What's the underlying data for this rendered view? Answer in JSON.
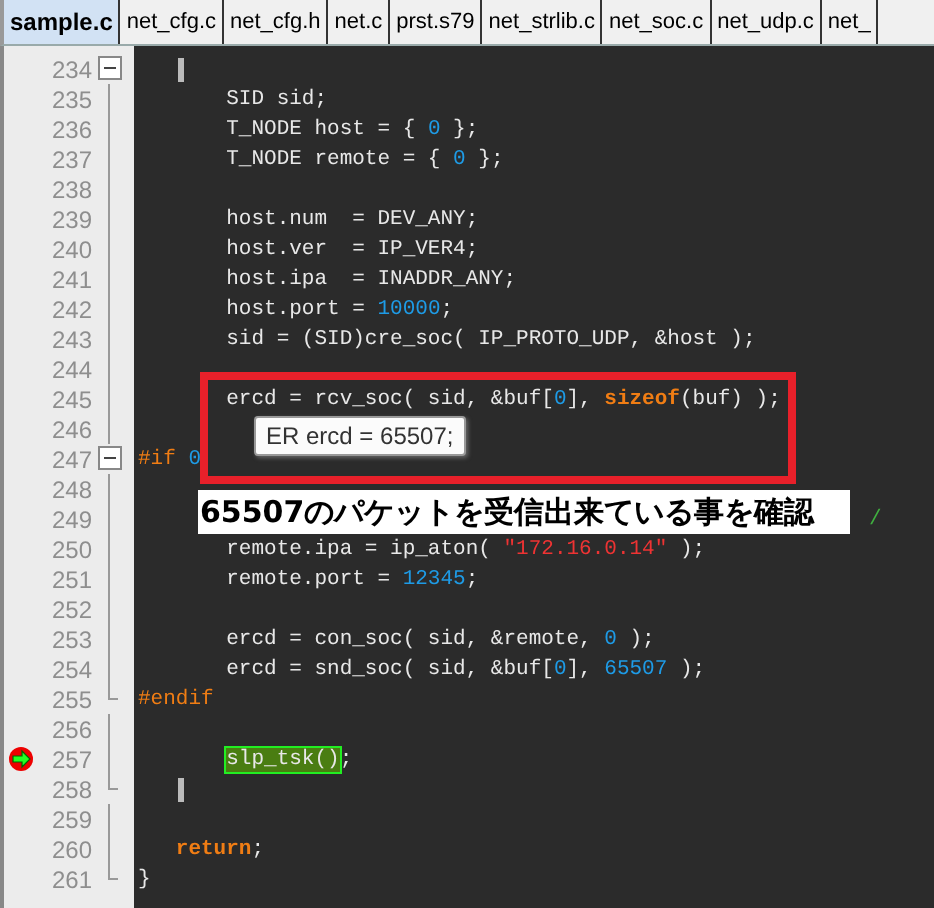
{
  "tabs": [
    {
      "label": "sample.c",
      "selected": true
    },
    {
      "label": "net_cfg.c",
      "selected": false
    },
    {
      "label": "net_cfg.h",
      "selected": false
    },
    {
      "label": "net.c",
      "selected": false
    },
    {
      "label": "prst.s79",
      "selected": false
    },
    {
      "label": "net_strlib.c",
      "selected": false
    },
    {
      "label": "net_soc.c",
      "selected": false
    },
    {
      "label": "net_udp.c",
      "selected": false
    },
    {
      "label": "net_",
      "selected": false
    }
  ],
  "lines": [
    {
      "number": "234",
      "kind": "fold-start",
      "current": false,
      "brace_match": true
    },
    {
      "number": "235",
      "kind": "body",
      "current": false,
      "brace_match": false,
      "tokens": [
        {
          "t": "       SID sid;",
          "kind": "plain"
        }
      ]
    },
    {
      "number": "236",
      "kind": "body",
      "current": false,
      "brace_match": false,
      "tokens": [
        {
          "t": "       T_NODE host = { ",
          "kind": "plain"
        },
        {
          "t": "0",
          "kind": "num"
        },
        {
          "t": " };",
          "kind": "plain"
        }
      ]
    },
    {
      "number": "237",
      "kind": "body",
      "current": false,
      "brace_match": false,
      "tokens": [
        {
          "t": "       T_NODE remote = { ",
          "kind": "plain"
        },
        {
          "t": "0",
          "kind": "num"
        },
        {
          "t": " };",
          "kind": "plain"
        }
      ]
    },
    {
      "number": "238",
      "kind": "body",
      "current": false,
      "brace_match": false
    },
    {
      "number": "239",
      "kind": "body",
      "current": false,
      "brace_match": false,
      "tokens": [
        {
          "t": "       host.num  = DEV_ANY;",
          "kind": "plain"
        }
      ]
    },
    {
      "number": "240",
      "kind": "body",
      "current": false,
      "brace_match": false,
      "tokens": [
        {
          "t": "       host.ver  = IP_VER4;",
          "kind": "plain"
        }
      ]
    },
    {
      "number": "241",
      "kind": "body",
      "current": false,
      "brace_match": false,
      "tokens": [
        {
          "t": "       host.ipa  = INADDR_ANY;",
          "kind": "plain"
        }
      ]
    },
    {
      "number": "242",
      "kind": "body",
      "current": false,
      "brace_match": false,
      "tokens": [
        {
          "t": "       host.port = ",
          "kind": "plain"
        },
        {
          "t": "10000",
          "kind": "num"
        },
        {
          "t": ";",
          "kind": "plain"
        }
      ]
    },
    {
      "number": "243",
      "kind": "body",
      "current": false,
      "brace_match": false,
      "tokens": [
        {
          "t": "       sid = (SID)cre_soc( IP_PROTO_UDP, &host );",
          "kind": "plain"
        }
      ]
    },
    {
      "number": "244",
      "kind": "body",
      "current": false,
      "brace_match": false
    },
    {
      "number": "245",
      "kind": "body",
      "current": false,
      "brace_match": false,
      "tokens": [
        {
          "t": "       ercd = rcv_soc( sid, &buf[",
          "kind": "plain"
        },
        {
          "t": "0",
          "kind": "num"
        },
        {
          "t": "], ",
          "kind": "plain"
        },
        {
          "t": "sizeof",
          "kind": "kw"
        },
        {
          "t": "(buf) );",
          "kind": "plain"
        }
      ]
    },
    {
      "number": "246",
      "kind": "body",
      "current": false,
      "brace_match": false
    },
    {
      "number": "247",
      "kind": "fold-start",
      "current": false,
      "brace_match": false,
      "tokens": [
        {
          "t": "#if",
          "kind": "pre"
        },
        {
          "t": " 0",
          "kind": "num"
        }
      ]
    },
    {
      "number": "248",
      "kind": "body",
      "current": false,
      "brace_match": false
    },
    {
      "number": "249",
      "kind": "body",
      "current": false,
      "brace_match": false,
      "tokens": [
        {
          "t": "                                                          /",
          "kind": "comment"
        }
      ]
    },
    {
      "number": "250",
      "kind": "body",
      "current": false,
      "brace_match": false,
      "tokens": [
        {
          "t": "       remote.ipa = ip_aton( ",
          "kind": "plain"
        },
        {
          "t": "\"172.16.0.14\"",
          "kind": "str"
        },
        {
          "t": " );",
          "kind": "plain"
        }
      ]
    },
    {
      "number": "251",
      "kind": "body",
      "current": false,
      "brace_match": false,
      "tokens": [
        {
          "t": "       remote.port = ",
          "kind": "plain"
        },
        {
          "t": "12345",
          "kind": "num"
        },
        {
          "t": ";",
          "kind": "plain"
        }
      ]
    },
    {
      "number": "252",
      "kind": "body",
      "current": false,
      "brace_match": false
    },
    {
      "number": "253",
      "kind": "body",
      "current": false,
      "brace_match": false,
      "tokens": [
        {
          "t": "       ercd = con_soc( sid, &remote, ",
          "kind": "plain"
        },
        {
          "t": "0",
          "kind": "num"
        },
        {
          "t": " );",
          "kind": "plain"
        }
      ]
    },
    {
      "number": "254",
      "kind": "body",
      "current": false,
      "brace_match": false,
      "tokens": [
        {
          "t": "       ercd = snd_soc( sid, &buf[",
          "kind": "plain"
        },
        {
          "t": "0",
          "kind": "num"
        },
        {
          "t": "], ",
          "kind": "plain"
        },
        {
          "t": "65507",
          "kind": "num"
        },
        {
          "t": " );",
          "kind": "plain"
        }
      ]
    },
    {
      "number": "255",
      "kind": "fold-end",
      "current": false,
      "brace_match": false,
      "tokens": [
        {
          "t": "#endif",
          "kind": "pre"
        }
      ]
    },
    {
      "number": "256",
      "kind": "body",
      "current": false,
      "brace_match": false
    },
    {
      "number": "257",
      "kind": "body",
      "current": true,
      "brace_match": false,
      "tokens": [
        {
          "t": "       slp_tsk()",
          "kind": "hl"
        },
        {
          "t": ";",
          "kind": "plain"
        }
      ]
    },
    {
      "number": "258",
      "kind": "fold-end",
      "current": false,
      "brace_match": true
    },
    {
      "number": "259",
      "kind": "body",
      "current": false,
      "brace_match": false
    },
    {
      "number": "260",
      "kind": "body",
      "current": false,
      "brace_match": false,
      "tokens": [
        {
          "t": "   return",
          "kind": "kw"
        },
        {
          "t": ";",
          "kind": "plain"
        }
      ]
    },
    {
      "number": "261",
      "kind": "fold-end",
      "current": false,
      "brace_match": false,
      "tokens": [
        {
          "t": "}",
          "kind": "plain"
        }
      ]
    }
  ],
  "tooltip": {
    "text": "ER ercd = 65507;"
  },
  "annotation": {
    "text": "65507のパケットを受信出来ている事を確認"
  }
}
